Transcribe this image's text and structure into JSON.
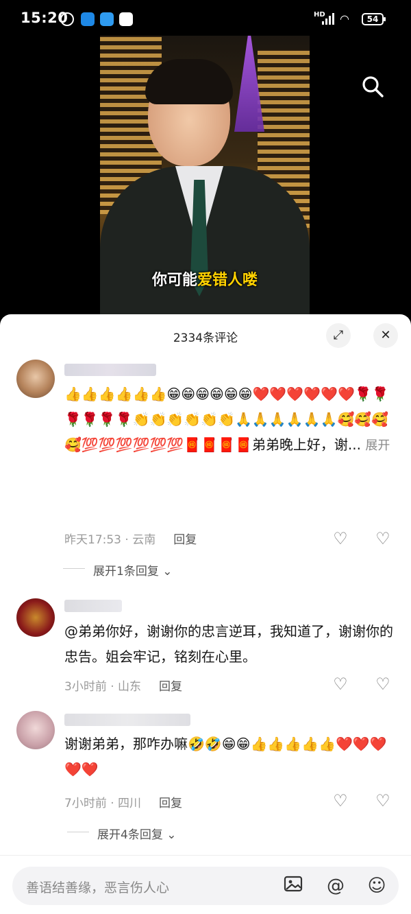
{
  "status_bar": {
    "time": "15:20",
    "network": "HD",
    "battery": "54"
  },
  "video": {
    "subtitle_prefix": "你可能",
    "subtitle_highlight": "爱错人喽"
  },
  "comments_panel": {
    "title": "2334条评论",
    "comments": [
      {
        "text": "👍👍👍👍👍👍😁😁😁😁😁😁❤️❤️❤️❤️❤️❤️🌹🌹🌹🌹🌹🌹👏👏👏👏👏👏🙏🙏🙏🙏🙏🙏🥰🥰🥰🥰💯💯💯💯💯💯🧧🧧🧧🧧弟弟晚上好，谢...",
        "more": "展开",
        "time": "昨天17:53",
        "location": "云南",
        "reply_label": "回复",
        "expand_replies": "展开1条回复"
      },
      {
        "text": "@弟弟你好，谢谢你的忠言逆耳，我知道了，谢谢你的忠告。姐会牢记，铭刻在心里。",
        "time": "3小时前",
        "location": "山东",
        "reply_label": "回复"
      },
      {
        "text": "谢谢弟弟，那咋办嘛🤣🤣😁😁👍👍👍👍👍❤️❤️❤️❤️❤️",
        "time": "7小时前",
        "location": "四川",
        "reply_label": "回复",
        "expand_replies": "展开4条回复"
      }
    ]
  },
  "input_bar": {
    "placeholder": "善语结善缘，恶言伤人心"
  },
  "icons": {
    "search": "search-icon",
    "expand": "expand-icon",
    "close": "close-icon",
    "like": "heart-icon",
    "dislike": "broken-heart-icon",
    "image": "image-icon",
    "mention": "at-icon",
    "emoji": "emoji-icon"
  }
}
